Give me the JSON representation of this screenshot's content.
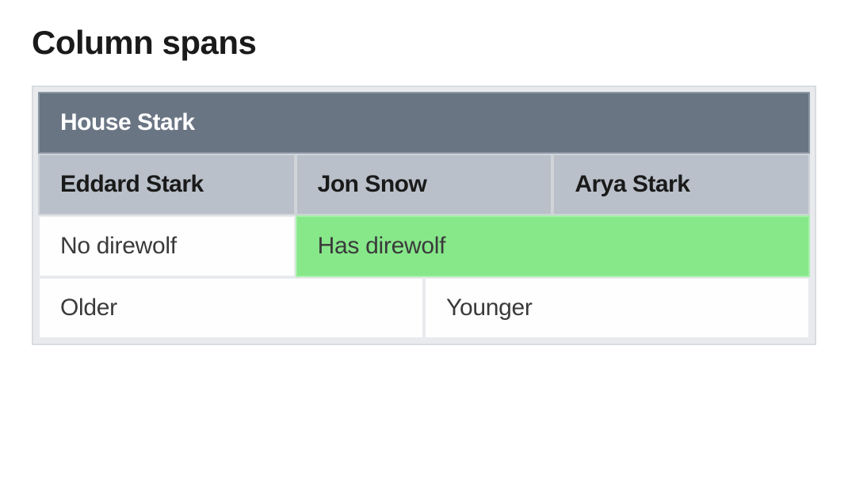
{
  "title": "Column spans",
  "table": {
    "header_top": "House Stark",
    "header_sub": [
      "Eddard Stark",
      "Jon Snow",
      "Arya Stark"
    ],
    "row1": {
      "c1": "No direwolf",
      "c2": "Has direwolf"
    },
    "row2": {
      "c1": "Older",
      "c2": "Younger"
    }
  },
  "chart_data": {
    "type": "table",
    "title": "Column spans",
    "columns": [
      "Eddard Stark",
      "Jon Snow",
      "Arya Stark"
    ],
    "column_group": "House Stark",
    "rows": [
      {
        "cells": [
          {
            "value": "No direwolf",
            "colspan": 1
          },
          {
            "value": "Has direwolf",
            "colspan": 2,
            "highlight": true
          }
        ]
      },
      {
        "cells": [
          {
            "value": "Older",
            "colspan": 2
          },
          {
            "value": "Younger",
            "colspan": 1
          }
        ]
      }
    ]
  }
}
